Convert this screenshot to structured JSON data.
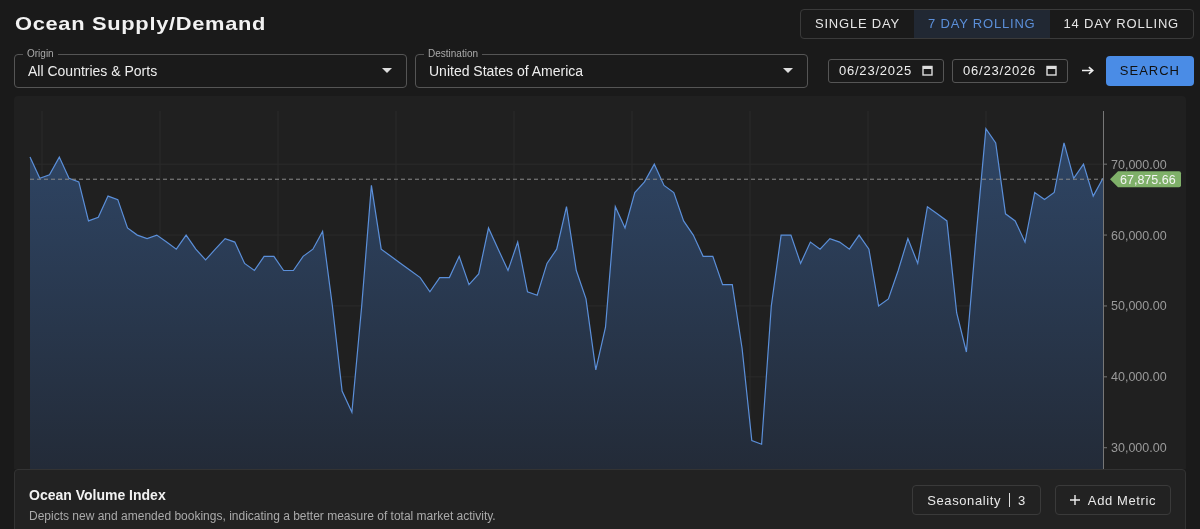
{
  "header": {
    "title": "Ocean Supply/Demand",
    "tabs": [
      {
        "label": "SINGLE DAY",
        "selected": false
      },
      {
        "label": "7 DAY ROLLING",
        "selected": true
      },
      {
        "label": "14 DAY ROLLING",
        "selected": false
      }
    ]
  },
  "filters": {
    "origin": {
      "label": "Origin",
      "value": "All Countries & Ports"
    },
    "destination": {
      "label": "Destination",
      "value": "United States of America"
    },
    "dates": [
      "06/23/2025",
      "06/23/2026"
    ],
    "search_button": "SEARCH"
  },
  "chart": {
    "chart_data": {
      "type": "area",
      "ylim": [
        27000,
        77500
      ],
      "yticks": [
        {
          "value": 30000,
          "label": "30,000.00"
        },
        {
          "value": 40000,
          "label": "40,000.00"
        },
        {
          "value": 50000,
          "label": "50,000.00"
        },
        {
          "value": 60000,
          "label": "60,000.00"
        },
        {
          "value": 70000,
          "label": "70,000.00"
        }
      ],
      "grid": true,
      "series": [
        {
          "color": "#5b8fd9",
          "values": [
            71000,
            68000,
            68500,
            71000,
            68000,
            67500,
            62000,
            62500,
            65500,
            65000,
            61000,
            60000,
            59500,
            60000,
            59000,
            58000,
            60000,
            58000,
            56500,
            58000,
            59500,
            59000,
            56000,
            55000,
            57000,
            57000,
            55000,
            55000,
            57000,
            58000,
            60500,
            50000,
            38000,
            35000,
            50000,
            67000,
            58000,
            57000,
            56000,
            55000,
            54000,
            52000,
            54000,
            54000,
            57000,
            53000,
            54500,
            61000,
            58000,
            55000,
            59000,
            52000,
            51500,
            56000,
            58000,
            64000,
            55000,
            51000,
            41000,
            47000,
            64000,
            61000,
            66000,
            67500,
            70000,
            67000,
            66000,
            62000,
            60000,
            57000,
            57000,
            53000,
            53000,
            44000,
            31000,
            30500,
            50000,
            60000,
            60000,
            56000,
            59000,
            58000,
            59500,
            59000,
            58000,
            60000,
            58000,
            50000,
            51000,
            55000,
            59500,
            56000,
            64000,
            63000,
            62000,
            49000,
            43500,
            60000,
            75000,
            73000,
            63000,
            62000,
            59000,
            66000,
            65000,
            66000,
            73000,
            68000,
            70000,
            65500,
            68000
          ]
        }
      ],
      "ref_lines": [
        {
          "axis": "y",
          "value": 67875.66,
          "label": "67,875.66"
        }
      ]
    }
  },
  "metric": {
    "title": "Ocean Volume Index",
    "description": "Depicts new and amended bookings, indicating a better measure of total market activity.",
    "seasonality": {
      "label": "Seasonality",
      "value": "3"
    },
    "add_button": "Add Metric"
  }
}
